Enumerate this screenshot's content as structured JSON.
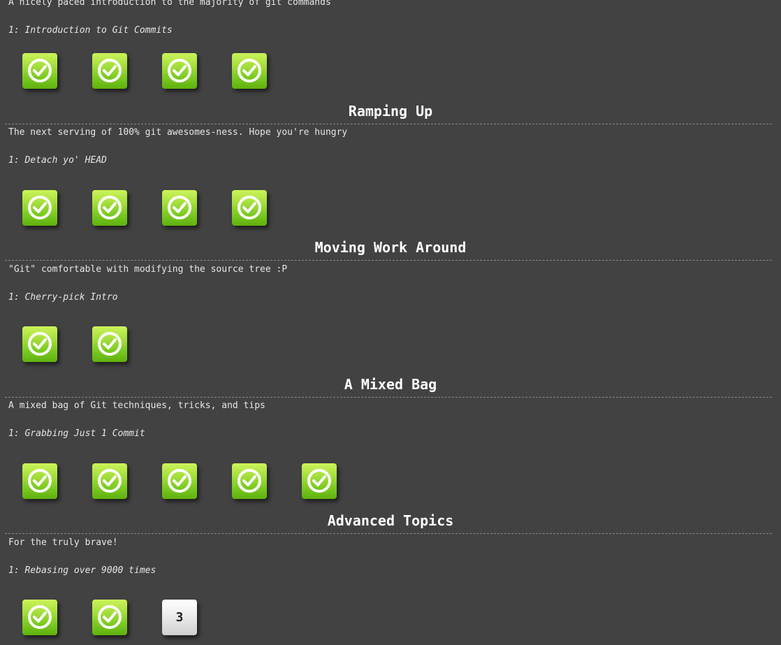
{
  "sections": [
    {
      "title": "",
      "about": "A nicely paced introduction to the majority of git commands",
      "level_name": "1: Introduction to Git Commits",
      "levels": [
        {
          "state": "solved",
          "label": ""
        },
        {
          "state": "solved",
          "label": ""
        },
        {
          "state": "solved",
          "label": ""
        },
        {
          "state": "solved",
          "label": ""
        }
      ]
    },
    {
      "title": "Ramping Up",
      "about": "The next serving of 100% git awesomes-ness. Hope you're hungry",
      "level_name": "1: Detach yo' HEAD",
      "levels": [
        {
          "state": "solved",
          "label": ""
        },
        {
          "state": "solved",
          "label": ""
        },
        {
          "state": "solved",
          "label": ""
        },
        {
          "state": "solved",
          "label": ""
        }
      ]
    },
    {
      "title": "Moving Work Around",
      "about": "\"Git\" comfortable with modifying the source tree :P",
      "level_name": "1: Cherry-pick Intro",
      "levels": [
        {
          "state": "solved",
          "label": ""
        },
        {
          "state": "solved",
          "label": ""
        }
      ]
    },
    {
      "title": "A Mixed Bag",
      "about": "A mixed bag of Git techniques, tricks, and tips",
      "level_name": "1: Grabbing Just 1 Commit",
      "levels": [
        {
          "state": "solved",
          "label": ""
        },
        {
          "state": "solved",
          "label": ""
        },
        {
          "state": "solved",
          "label": ""
        },
        {
          "state": "solved",
          "label": ""
        },
        {
          "state": "solved",
          "label": ""
        }
      ]
    },
    {
      "title": "Advanced Topics",
      "about": "For the truly brave!",
      "level_name": "1: Rebasing over 9000 times",
      "levels": [
        {
          "state": "solved",
          "label": ""
        },
        {
          "state": "solved",
          "label": ""
        },
        {
          "state": "unsolved",
          "label": "3"
        }
      ]
    }
  ],
  "colors": {
    "background": "#424242",
    "solved_green": "#7fcc25",
    "unsolved_gray": "#e6e6e6"
  },
  "icons": {
    "solved": "check-circle-icon"
  }
}
